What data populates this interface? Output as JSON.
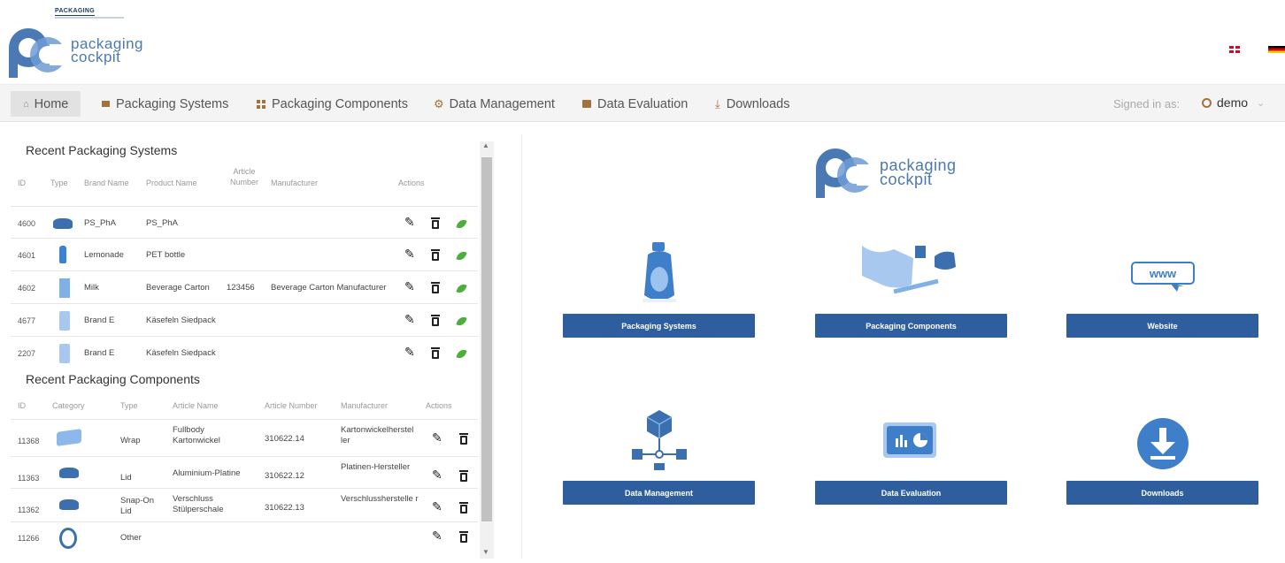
{
  "header": {
    "small_brand": "PACKAGING",
    "logo_line1": "packaging",
    "logo_line2": "cockpit",
    "languages": [
      "en",
      "de"
    ]
  },
  "nav": {
    "items": [
      {
        "label": "Home",
        "icon": "home-icon"
      },
      {
        "label": "Packaging Systems",
        "icon": "list-icon"
      },
      {
        "label": "Packaging Components",
        "icon": "grid-icon"
      },
      {
        "label": "Data Management",
        "icon": "gear-icon"
      },
      {
        "label": "Data Evaluation",
        "icon": "chart-icon"
      },
      {
        "label": "Downloads",
        "icon": "download-icon"
      }
    ],
    "signed_in_label": "Signed in as:",
    "user": "demo"
  },
  "systems": {
    "title": "Recent Packaging Systems",
    "columns": [
      "ID",
      "Type",
      "Brand Name",
      "Product Name",
      "Article Number",
      "Manufacturer",
      "Actions"
    ],
    "rows": [
      {
        "id": "4600",
        "type": "lid",
        "brand": "PS_PhA",
        "product": "PS_PhA",
        "article": "",
        "manufacturer": ""
      },
      {
        "id": "4601",
        "type": "bottle",
        "brand": "Lemonade",
        "product": "PET bottle",
        "article": "",
        "manufacturer": ""
      },
      {
        "id": "4602",
        "type": "carton",
        "brand": "Milk",
        "product": "Beverage Carton",
        "article": "123456",
        "manufacturer": "Beverage Carton Manufacturer"
      },
      {
        "id": "4677",
        "type": "pouch",
        "brand": "Brand E",
        "product": "Käsefeln Siedpack",
        "article": "",
        "manufacturer": ""
      },
      {
        "id": "2207",
        "type": "pouch",
        "brand": "Brand E",
        "product": "Käsefeln Siedpack",
        "article": "",
        "manufacturer": ""
      }
    ]
  },
  "components": {
    "title": "Recent Packaging Components",
    "columns": [
      "ID",
      "Category",
      "Type",
      "Article Name",
      "Article Number",
      "Manufacturer",
      "Actions"
    ],
    "rows": [
      {
        "id": "11368",
        "category": "wrap",
        "type": "Wrap",
        "name": "Fullbody Kartonwickel",
        "number": "310622.14",
        "manufacturer": "Kartonwickelherstel ler"
      },
      {
        "id": "11363",
        "category": "lid",
        "type": "Lid",
        "name": "Aluminium-Platine",
        "number": "310622.12",
        "manufacturer": "Platinen-Hersteller"
      },
      {
        "id": "11362",
        "category": "lid",
        "type": "Snap-On Lid",
        "name": "Verschluss Stülperschale",
        "number": "310622.13",
        "manufacturer": "Verschlussherstelle r"
      },
      {
        "id": "11266",
        "category": "other",
        "type": "Other",
        "name": "",
        "number": "",
        "manufacturer": ""
      }
    ]
  },
  "center_logo": {
    "line1": "packaging",
    "line2": "cockpit"
  },
  "tiles": [
    {
      "label": "Packaging Systems",
      "icon": "bottle-icon"
    },
    {
      "label": "Packaging Components",
      "icon": "components-icon"
    },
    {
      "label": "Website",
      "icon": "www-icon"
    },
    {
      "label": "Data Management",
      "icon": "network-icon"
    },
    {
      "label": "Data Evaluation",
      "icon": "dashboard-icon"
    },
    {
      "label": "Downloads",
      "icon": "download-circle-icon"
    }
  ],
  "colors": {
    "accent": "#2e5e9e",
    "logo": "#4b79b3",
    "nav_icon": "#a3723c",
    "eco": "#4caf3c"
  }
}
